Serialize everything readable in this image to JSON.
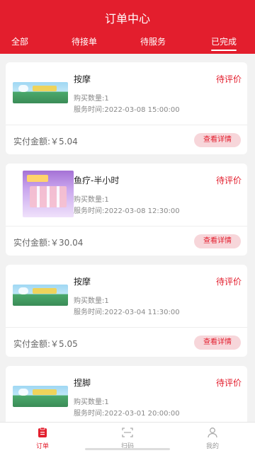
{
  "header": {
    "title": "订单中心",
    "tabs": [
      "全部",
      "待接单",
      "待服务",
      "已完成"
    ],
    "active_tab": "已完成"
  },
  "orders": [
    {
      "name": "按摩",
      "status": "待评价",
      "quantity": "购买数量:1",
      "time": "服务时间:2022-03-08 15:00:00",
      "amount": "实付金额:￥5.04",
      "button": "查看详情"
    },
    {
      "name": "鱼疗-半小时",
      "status": "待评价",
      "quantity": "购买数量:1",
      "time": "服务时间:2022-03-08 12:30:00",
      "amount": "实付金额:￥30.04",
      "button": "查看详情"
    },
    {
      "name": "按摩",
      "status": "待评价",
      "quantity": "购买数量:1",
      "time": "服务时间:2022-03-04 11:30:00",
      "amount": "实付金额:￥5.05",
      "button": "查看详情"
    },
    {
      "name": "捏脚",
      "status": "待评价",
      "quantity": "购买数量:1",
      "time": "服务时间:2022-03-01 20:00:00",
      "amount": "",
      "button": ""
    }
  ],
  "tabbar": {
    "items": [
      {
        "label": "订单",
        "icon": "order-icon"
      },
      {
        "label": "扫码",
        "icon": "scan-icon"
      },
      {
        "label": "我的",
        "icon": "user-icon"
      }
    ],
    "active": "订单"
  },
  "colors": {
    "brand": "#e31e2d",
    "button_bg": "#f7d6da",
    "page_bg": "#f2f2f2"
  }
}
